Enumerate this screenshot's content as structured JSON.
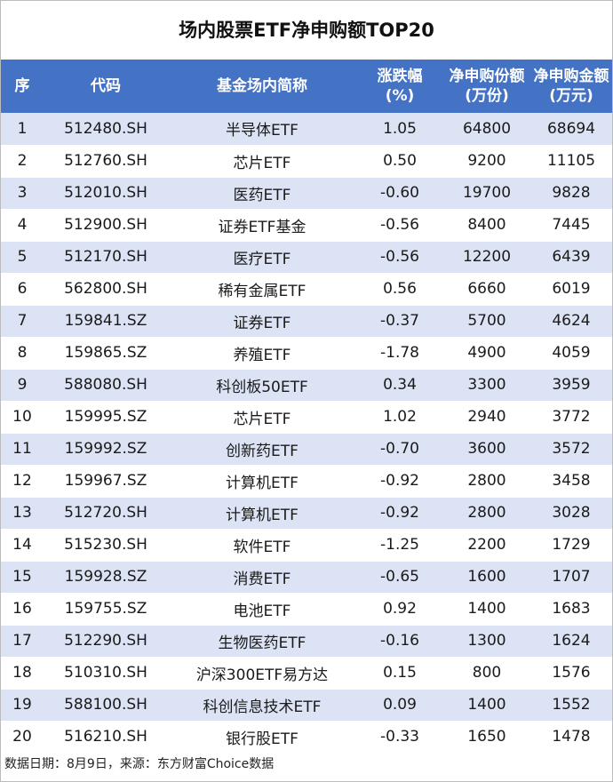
{
  "title": "场内股票ETF净申购额TOP20",
  "columns": [
    {
      "line1": "序",
      "line2": ""
    },
    {
      "line1": "代码",
      "line2": ""
    },
    {
      "line1": "基金场内简称",
      "line2": ""
    },
    {
      "line1": "涨跌幅",
      "line2": "(%)"
    },
    {
      "line1": "净申购份额",
      "line2": "(万份)"
    },
    {
      "line1": "净申购金额",
      "line2": "(万元)"
    }
  ],
  "rows": [
    [
      "1",
      "512480.SH",
      "半导体ETF",
      "1.05",
      "64800",
      "68694"
    ],
    [
      "2",
      "512760.SH",
      "芯片ETF",
      "0.50",
      "9200",
      "11105"
    ],
    [
      "3",
      "512010.SH",
      "医药ETF",
      "-0.60",
      "19700",
      "9828"
    ],
    [
      "4",
      "512900.SH",
      "证券ETF基金",
      "-0.56",
      "8400",
      "7445"
    ],
    [
      "5",
      "512170.SH",
      "医疗ETF",
      "-0.56",
      "12200",
      "6439"
    ],
    [
      "6",
      "562800.SH",
      "稀有金属ETF",
      "0.56",
      "6660",
      "6019"
    ],
    [
      "7",
      "159841.SZ",
      "证券ETF",
      "-0.37",
      "5700",
      "4624"
    ],
    [
      "8",
      "159865.SZ",
      "养殖ETF",
      "-1.78",
      "4900",
      "4059"
    ],
    [
      "9",
      "588080.SH",
      "科创板50ETF",
      "0.34",
      "3300",
      "3959"
    ],
    [
      "10",
      "159995.SZ",
      "芯片ETF",
      "1.02",
      "2940",
      "3772"
    ],
    [
      "11",
      "159992.SZ",
      "创新药ETF",
      "-0.70",
      "3600",
      "3572"
    ],
    [
      "12",
      "159967.SZ",
      "计算机ETF",
      "-0.92",
      "2800",
      "3458"
    ],
    [
      "13",
      "512720.SH",
      "计算机ETF",
      "-0.92",
      "2800",
      "3028"
    ],
    [
      "14",
      "515230.SH",
      "软件ETF",
      "-1.25",
      "2200",
      "1729"
    ],
    [
      "15",
      "159928.SZ",
      "消费ETF",
      "-0.65",
      "1600",
      "1707"
    ],
    [
      "16",
      "159755.SZ",
      "电池ETF",
      "0.92",
      "1400",
      "1683"
    ],
    [
      "17",
      "512290.SH",
      "生物医药ETF",
      "-0.16",
      "1300",
      "1624"
    ],
    [
      "18",
      "510310.SH",
      "沪深300ETF易方达",
      "0.15",
      "800",
      "1576"
    ],
    [
      "19",
      "588100.SH",
      "科创信息技术ETF",
      "0.09",
      "1400",
      "1552"
    ],
    [
      "20",
      "516210.SH",
      "银行股ETF",
      "-0.33",
      "1650",
      "1478"
    ]
  ],
  "footer": "数据日期：8月9日，来源：东方财富Choice数据",
  "colors": {
    "header_bg": "#4472c4",
    "stripe_bg": "#dbe3f4"
  }
}
